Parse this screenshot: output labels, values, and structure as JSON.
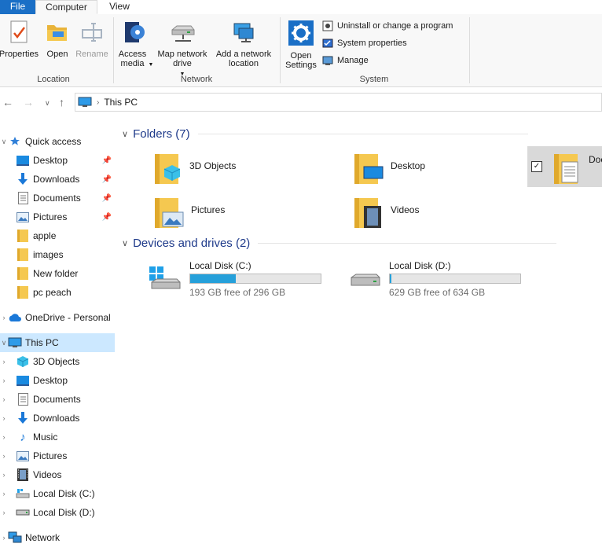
{
  "tabs": {
    "file": "File",
    "computer": "Computer",
    "view": "View"
  },
  "ribbon": {
    "location": {
      "label": "Location",
      "properties": "Properties",
      "open": "Open",
      "rename": "Rename"
    },
    "network": {
      "label": "Network",
      "access_media": "Access media",
      "map_network_drive": "Map network drive",
      "add_network_location": "Add a network location"
    },
    "system": {
      "label": "System",
      "open_settings": "Open Settings",
      "uninstall": "Uninstall or change a program",
      "system_properties": "System properties",
      "manage": "Manage"
    }
  },
  "address": {
    "path": "This PC"
  },
  "tree": {
    "quick_access": "Quick access",
    "quick_items": [
      "Desktop",
      "Downloads",
      "Documents",
      "Pictures",
      "apple",
      "images",
      "New folder",
      "pc peach"
    ],
    "onedrive": "OneDrive - Personal",
    "this_pc": "This PC",
    "pc_items": [
      "3D Objects",
      "Desktop",
      "Documents",
      "Downloads",
      "Music",
      "Pictures",
      "Videos",
      "Local Disk (C:)",
      "Local Disk (D:)"
    ],
    "network": "Network"
  },
  "folders": {
    "header": "Folders (7)",
    "items": [
      "3D Objects",
      "Desktop",
      "Doc",
      "Pictures",
      "Videos"
    ]
  },
  "drives": {
    "header": "Devices and drives (2)",
    "items": [
      {
        "name": "Local Disk (C:)",
        "free": "193 GB free of 296 GB",
        "used_fraction": 0.35
      },
      {
        "name": "Local Disk (D:)",
        "free": "629 GB free of 634 GB",
        "used_fraction": 0.01
      }
    ]
  },
  "colors": {
    "accent": "#1a6fc6",
    "selection": "#cce8ff",
    "folder": "#f5c850",
    "bar": "#26a0da"
  }
}
